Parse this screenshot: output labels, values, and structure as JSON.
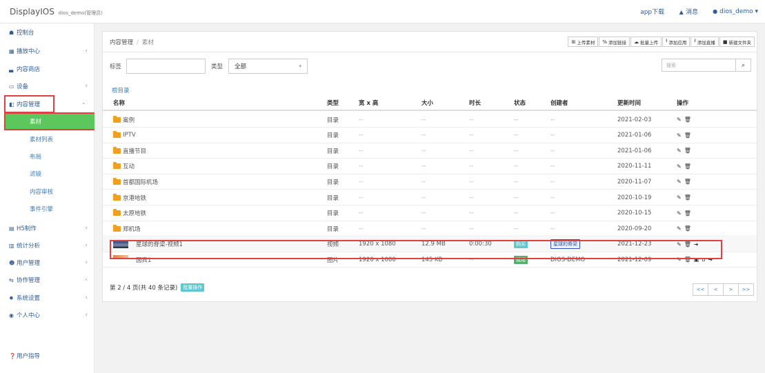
{
  "app": {
    "title": "DisplayIOS",
    "user_sub": "dios_demo(管理员)"
  },
  "topbar": {
    "app_download": "app下载",
    "messages": "消息",
    "username": "dios_demo"
  },
  "sidebar": {
    "items": [
      {
        "label": "控制台",
        "icon": "dashboard-icon"
      },
      {
        "label": "播放中心",
        "icon": "grid-icon",
        "arrow": "‹"
      },
      {
        "label": "内容商店",
        "icon": "store-icon"
      },
      {
        "label": "设备",
        "icon": "monitor-icon",
        "arrow": "‹"
      },
      {
        "label": "内容管理",
        "icon": "content-icon",
        "arrow": "⌄"
      },
      {
        "label": "H5制作",
        "icon": "h5-icon",
        "arrow": "‹"
      },
      {
        "label": "统计分析",
        "icon": "chart-icon",
        "arrow": "‹"
      },
      {
        "label": "用户管理",
        "icon": "users-icon",
        "arrow": "‹"
      },
      {
        "label": "协作管理",
        "icon": "collab-icon",
        "arrow": "‹"
      },
      {
        "label": "系统设置",
        "icon": "gear-icon",
        "arrow": "‹"
      },
      {
        "label": "个人中心",
        "icon": "user-icon",
        "arrow": "‹"
      }
    ],
    "sub_items": [
      "素材",
      "素材列表",
      "布局",
      "滤镜",
      "内容审核",
      "事件引擎"
    ],
    "guide": "用户指导"
  },
  "breadcrumb": {
    "parent": "内容管理",
    "current": "素材"
  },
  "toolbar": [
    "上传素材",
    "添加链接",
    "批量上传",
    "添加应用",
    "添加直播",
    "新建文件夹"
  ],
  "filters": {
    "tag_label": "标签",
    "type_label": "类型",
    "type_value": "全部",
    "search_placeholder": "搜索"
  },
  "root_dir": "根目录",
  "table": {
    "headers": [
      "名称",
      "类型",
      "宽 x 高",
      "大小",
      "时长",
      "状态",
      "创建者",
      "更新时间",
      "操作"
    ],
    "rows": [
      {
        "name": "案例",
        "type": "目录",
        "dims": "--",
        "size": "--",
        "dur": "--",
        "status": "--",
        "creator": "--",
        "time": "2021-02-03"
      },
      {
        "name": "IPTV",
        "type": "目录",
        "dims": "--",
        "size": "--",
        "dur": "--",
        "status": "--",
        "creator": "--",
        "time": "2021-01-06"
      },
      {
        "name": "直播节目",
        "type": "目录",
        "dims": "--",
        "size": "--",
        "dur": "--",
        "status": "--",
        "creator": "--",
        "time": "2021-01-06"
      },
      {
        "name": "互动",
        "type": "目录",
        "dims": "--",
        "size": "--",
        "dur": "--",
        "status": "--",
        "creator": "--",
        "time": "2020-11-11"
      },
      {
        "name": "首都国际机场",
        "type": "目录",
        "dims": "--",
        "size": "--",
        "dur": "--",
        "status": "--",
        "creator": "--",
        "time": "2020-11-07"
      },
      {
        "name": "京港地铁",
        "type": "目录",
        "dims": "--",
        "size": "--",
        "dur": "--",
        "status": "--",
        "creator": "--",
        "time": "2020-10-19"
      },
      {
        "name": "太原地铁",
        "type": "目录",
        "dims": "--",
        "size": "--",
        "dur": "--",
        "status": "--",
        "creator": "--",
        "time": "2020-10-15"
      },
      {
        "name": "郑机场",
        "type": "目录",
        "dims": "--",
        "size": "--",
        "dur": "--",
        "status": "--",
        "creator": "--",
        "time": "2020-09-20"
      },
      {
        "name": "星球的脊梁-视频1",
        "type": "视频",
        "dims": "1920 x 1080",
        "size": "12.9 MB",
        "dur": "0:00:30",
        "status": "购买",
        "creator": "星球的脊梁",
        "time": "2021-12-23"
      },
      {
        "name": "国宾1",
        "type": "图片",
        "dims": "1920 x 1080",
        "size": "145 KB",
        "dur": "--",
        "status": "就绪",
        "creator": "DIOS-DEMO",
        "time": "2021-12-09"
      }
    ]
  },
  "pagination": {
    "info": "第 2 / 4 页(共 40 条记录)",
    "batch": "批量操作",
    "buttons": [
      "<<",
      "<",
      ">",
      ">>"
    ]
  }
}
